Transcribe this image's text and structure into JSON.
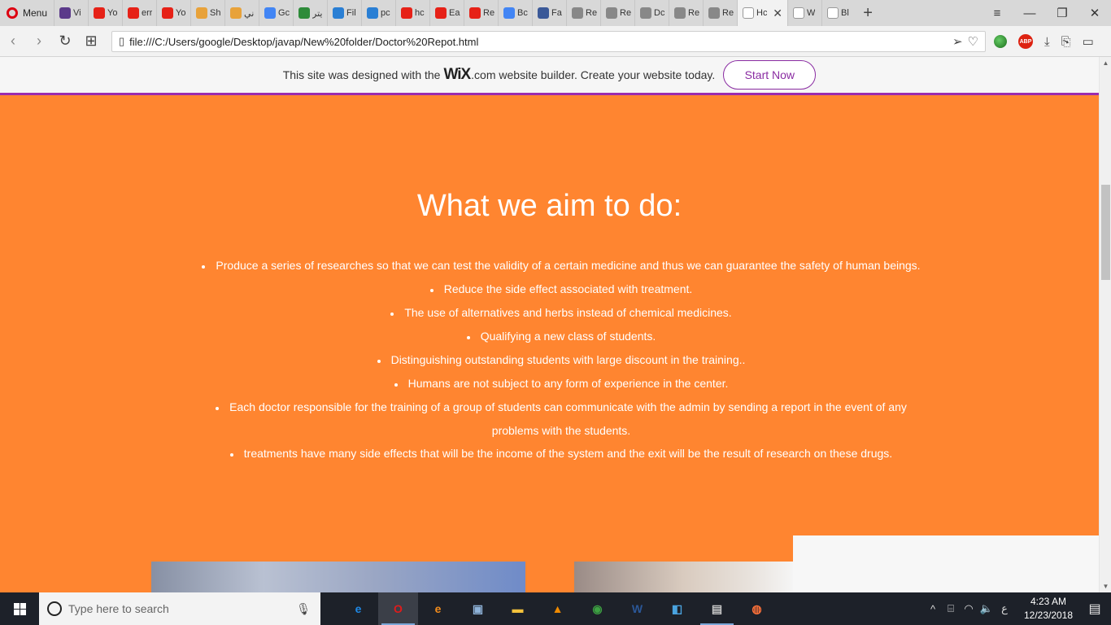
{
  "browser": {
    "menu_label": "Menu",
    "tabs": [
      {
        "label": "Vi",
        "icon": "vk-icon",
        "color": "#5b3a8a"
      },
      {
        "label": "Yo",
        "icon": "youtube-icon",
        "color": "#e62117"
      },
      {
        "label": "err",
        "icon": "youtube-icon",
        "color": "#e62117"
      },
      {
        "label": "Yo",
        "icon": "youtube-icon",
        "color": "#e62117"
      },
      {
        "label": "Sh",
        "icon": "chain-icon",
        "color": "#e8a23a"
      },
      {
        "label": "ني",
        "icon": "chain-icon",
        "color": "#e8a23a"
      },
      {
        "label": "Gc",
        "icon": "google-icon",
        "color": "#4285f4"
      },
      {
        "label": "يتر",
        "icon": "check-icon",
        "color": "#2e8b3a"
      },
      {
        "label": "Fil",
        "icon": "spinner-icon",
        "color": "#2a7fd4"
      },
      {
        "label": "pc",
        "icon": "spinner-icon",
        "color": "#2a7fd4"
      },
      {
        "label": "hc",
        "icon": "youtube-icon",
        "color": "#e62117"
      },
      {
        "label": "Ea",
        "icon": "youtube-icon",
        "color": "#e62117"
      },
      {
        "label": "Re",
        "icon": "youtube-icon",
        "color": "#e62117"
      },
      {
        "label": "Bc",
        "icon": "google-icon",
        "color": "#4285f4"
      },
      {
        "label": "Fa",
        "icon": "facebook-icon",
        "color": "#3b5998"
      },
      {
        "label": "Re",
        "icon": "document-icon",
        "color": "#888888"
      },
      {
        "label": "Re",
        "icon": "document-icon",
        "color": "#888888"
      },
      {
        "label": "Dc",
        "icon": "document-icon",
        "color": "#888888"
      },
      {
        "label": "Re",
        "icon": "document-icon",
        "color": "#888888"
      },
      {
        "label": "Re",
        "icon": "document-icon",
        "color": "#888888"
      }
    ],
    "active_tab": {
      "label": "Hc",
      "icon": "document-icon"
    },
    "trailing_tabs": [
      {
        "label": "W",
        "icon": "document-icon"
      },
      {
        "label": "Bl",
        "icon": "document-icon"
      }
    ],
    "url": "file:///C:/Users/google/Desktop/javap/New%20folder/Doctor%20Repot.html"
  },
  "wix_banner": {
    "prefix": "This site was designed with the",
    "logo": "WiX",
    "suffix": ".com website builder. Create your website today.",
    "button": "Start Now",
    "accent": "#9c2cae"
  },
  "page": {
    "background": "#ff8530",
    "title": "What we aim to do:",
    "items": [
      "Produce a series of researches so that we can test the validity of a certain medicine and thus we can guarantee the safety of human beings.",
      "Reduce the side effect associated with treatment.",
      "The use of alternatives and herbs instead of chemical medicines.",
      "Qualifying a new class of students.",
      "Distinguishing outstanding students with large discount in the training..",
      "Humans are not subject to any form of experience in the center.",
      "Each doctor responsible for the training of a group of students can communicate with the admin by sending a report in the event of any problems with the students.",
      "treatments have many side effects that will be the income of the system and the exit will be the result of research on these drugs."
    ]
  },
  "taskbar": {
    "search_placeholder": "Type here to search",
    "apps": [
      {
        "name": "edge-icon",
        "glyph": "e",
        "color": "#1e88e5",
        "running": false
      },
      {
        "name": "opera-icon",
        "glyph": "O",
        "color": "#e01b1b",
        "running": true,
        "active": true
      },
      {
        "name": "edge-beta-icon",
        "glyph": "e",
        "color": "#f28c1c",
        "running": false
      },
      {
        "name": "monitor-icon",
        "glyph": "▣",
        "color": "#8fb3d9",
        "running": false
      },
      {
        "name": "file-explorer-icon",
        "glyph": "▬",
        "color": "#f3c23c",
        "running": false
      },
      {
        "name": "vlc-icon",
        "glyph": "▲",
        "color": "#f08a00",
        "running": false
      },
      {
        "name": "download-manager-icon",
        "glyph": "◉",
        "color": "#3da142",
        "running": false
      },
      {
        "name": "word-icon",
        "glyph": "W",
        "color": "#2b5797",
        "running": false
      },
      {
        "name": "remote-icon",
        "glyph": "◧",
        "color": "#4aa3df",
        "running": false
      },
      {
        "name": "movie-maker-icon",
        "glyph": "▤",
        "color": "#c7c7c7",
        "running": true
      },
      {
        "name": "firefox-icon",
        "glyph": "◍",
        "color": "#ff7139",
        "running": false
      }
    ],
    "language": "ع",
    "time": "4:23 AM",
    "date": "12/23/2018"
  }
}
